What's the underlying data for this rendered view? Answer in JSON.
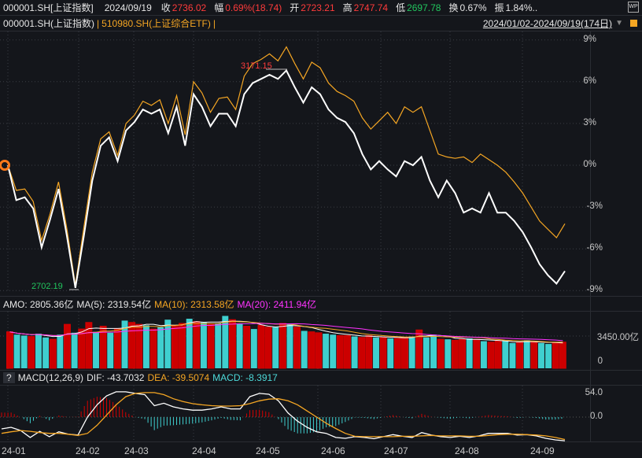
{
  "header": {
    "symbol": "000001.SH[上证指数]",
    "date": "2024/09/19",
    "close_label": "收",
    "close": "2736.02",
    "change_label": "幅",
    "change": "0.69%(18.74)",
    "open_label": "开",
    "open": "2723.21",
    "high_label": "高",
    "high": "2747.74",
    "low_label": "低",
    "low": "2697.78",
    "turnover_label": "换",
    "turnover": "0.67%",
    "amp_label": "振",
    "amp": "1.84%..",
    "wp_icon": "WP"
  },
  "compare": {
    "main": "000001.SH(上证指数)",
    "sep": "|",
    "second": "510980.SH(上证综合ETF)",
    "sep2": "|",
    "range": "2024/01/02-2024/09/19(174日)"
  },
  "chart_data": {
    "type": "line",
    "yaxis_ticks": [
      "9%",
      "6%",
      "3%",
      "0%",
      "-3%",
      "-6%",
      "-9%"
    ],
    "ylim": [
      -9,
      9
    ],
    "annotations": {
      "high": "3171.15",
      "low": "2702.19"
    },
    "series": [
      {
        "name": "000001.SH",
        "color": "#ffffff",
        "values": [
          0,
          -2.5,
          -2.3,
          -3.1,
          -5.9,
          -3.9,
          -1.7,
          -5.1,
          -8.8,
          -5.1,
          -1.1,
          1.4,
          2.0,
          0.3,
          2.5,
          3.1,
          4.0,
          3.7,
          4.0,
          2.3,
          4.2,
          1.4,
          5.1,
          4.2,
          2.8,
          3.7,
          3.7,
          2.8,
          5.1,
          5.9,
          6.2,
          6.5,
          6.2,
          6.8,
          5.6,
          4.5,
          5.6,
          5.1,
          4.0,
          3.4,
          3.1,
          2.3,
          0.8,
          -0.3,
          0.3,
          -0.3,
          -0.8,
          0.3,
          0,
          0.6,
          -1.1,
          -2.3,
          -1.1,
          -2.0,
          -3.4,
          -3.1,
          -3.4,
          -2.0,
          -3.4,
          -3.4,
          -4.0,
          -4.8,
          -5.9,
          -7.1,
          -7.9,
          -8.5,
          -7.6
        ]
      },
      {
        "name": "510980.SH",
        "color": "#f5a623",
        "values": [
          0,
          -1.8,
          -1.7,
          -2.6,
          -5.4,
          -3.5,
          -1.2,
          -4.6,
          -8.6,
          -4.5,
          -0.5,
          1.9,
          2.4,
          0.7,
          3.0,
          3.6,
          4.6,
          4.3,
          4.7,
          3.0,
          5.0,
          2.2,
          6.0,
          5.2,
          3.8,
          4.8,
          4.9,
          4.0,
          6.4,
          7.3,
          7.6,
          8.0,
          7.5,
          8.5,
          7.3,
          6.2,
          7.4,
          7.0,
          5.9,
          5.3,
          5.0,
          4.6,
          3.4,
          2.6,
          3.2,
          3.8,
          3.0,
          4.2,
          3.8,
          4.2,
          2.5,
          0.8,
          0.6,
          0.5,
          0.6,
          0.2,
          0.8,
          0.4,
          0.0,
          -0.5,
          -1.2,
          -2.0,
          -3.0,
          -4.0,
          -4.6,
          -5.2,
          -4.2
        ]
      }
    ],
    "xaxis_ticks": [
      "24-01",
      "24-02",
      "24-03",
      "24-04",
      "24-05",
      "24-06",
      "24-07",
      "24-08",
      "24-09"
    ]
  },
  "volume": {
    "amo": "AMO: 2805.36亿",
    "ma5": "MA(5): 2319.54亿",
    "ma10": "MA(10): 2313.58亿",
    "ma20": "MA(20): 2411.94亿",
    "axis_mid": "3450.00亿",
    "axis_zero": "0",
    "values": [
      3900,
      3600,
      3500,
      3400,
      3700,
      3300,
      3100,
      3600,
      4700,
      3800,
      4200,
      4900,
      3900,
      4500,
      3800,
      4200,
      5100,
      4900,
      4700,
      4600,
      4200,
      4400,
      5200,
      4600,
      4800,
      5300,
      5000,
      4900,
      4700,
      4800,
      5600,
      5200,
      4800,
      4500,
      4200,
      4600,
      4400,
      4400,
      4800,
      4700,
      4400,
      4000,
      3900,
      3800,
      3700,
      3600,
      3500,
      3500,
      3400,
      3300,
      3500,
      3300,
      3300,
      3200,
      3200,
      3300,
      3400,
      4100,
      3300,
      3600,
      3100,
      3100,
      3000,
      3100,
      3200,
      3100,
      2900,
      2800,
      2900,
      2900,
      2700,
      2800,
      3000,
      2800,
      2700,
      2600,
      2700,
      2800
    ],
    "up": [
      1,
      0,
      0,
      1,
      0,
      0,
      1,
      0,
      1,
      0,
      1,
      1,
      0,
      1,
      0,
      1,
      0,
      1,
      1,
      0,
      1,
      0,
      0,
      1,
      1,
      0,
      1,
      0,
      1,
      0,
      0,
      1,
      0,
      1,
      0,
      1,
      1,
      0,
      1,
      0,
      1,
      0,
      1,
      1,
      0,
      0,
      1,
      1,
      0,
      1,
      1,
      0,
      1,
      0,
      1,
      1,
      0,
      1,
      0,
      0,
      1,
      0,
      1,
      1,
      0,
      1,
      0,
      1,
      1,
      0,
      0,
      1,
      0,
      1,
      0,
      0,
      1,
      1
    ]
  },
  "macd": {
    "help": "?",
    "title": "MACD(12,26,9)",
    "dif": "DIF: -43.7032",
    "dea": "DEA: -39.5074",
    "macd": "MACD: -8.3917",
    "axis_top": "54.0",
    "axis_zero": "0.0",
    "dif_values": [
      -29,
      -25,
      -33,
      -50,
      -35,
      -48,
      -36,
      -42,
      -44,
      0,
      30,
      52,
      62,
      62,
      58,
      55,
      28,
      34,
      25,
      20,
      17,
      17,
      20,
      25,
      20,
      20,
      50,
      58,
      56,
      40,
      10,
      -10,
      -25,
      -36,
      -40,
      -50,
      -52,
      -48,
      -50,
      -53,
      -48,
      -43,
      -47,
      -50,
      -38,
      -44,
      -48,
      -50,
      -47,
      -50,
      -46,
      -40,
      -40,
      -40,
      -44,
      -43,
      -46,
      -52,
      -56,
      -58
    ],
    "dea_values": [
      -40,
      -36,
      -33,
      -35,
      -38,
      -40,
      -40,
      -42,
      -45,
      -40,
      -20,
      5,
      30,
      50,
      58,
      60,
      60,
      55,
      45,
      38,
      33,
      30,
      28,
      27,
      27,
      28,
      33,
      40,
      44,
      45,
      40,
      30,
      15,
      0,
      -15,
      -28,
      -40,
      -47,
      -48,
      -48,
      -48,
      -48,
      -47,
      -47,
      -46,
      -45,
      -46,
      -46,
      -46,
      -47,
      -47,
      -45,
      -43,
      -42,
      -42,
      -43,
      -44,
      -46,
      -50,
      -55
    ]
  }
}
